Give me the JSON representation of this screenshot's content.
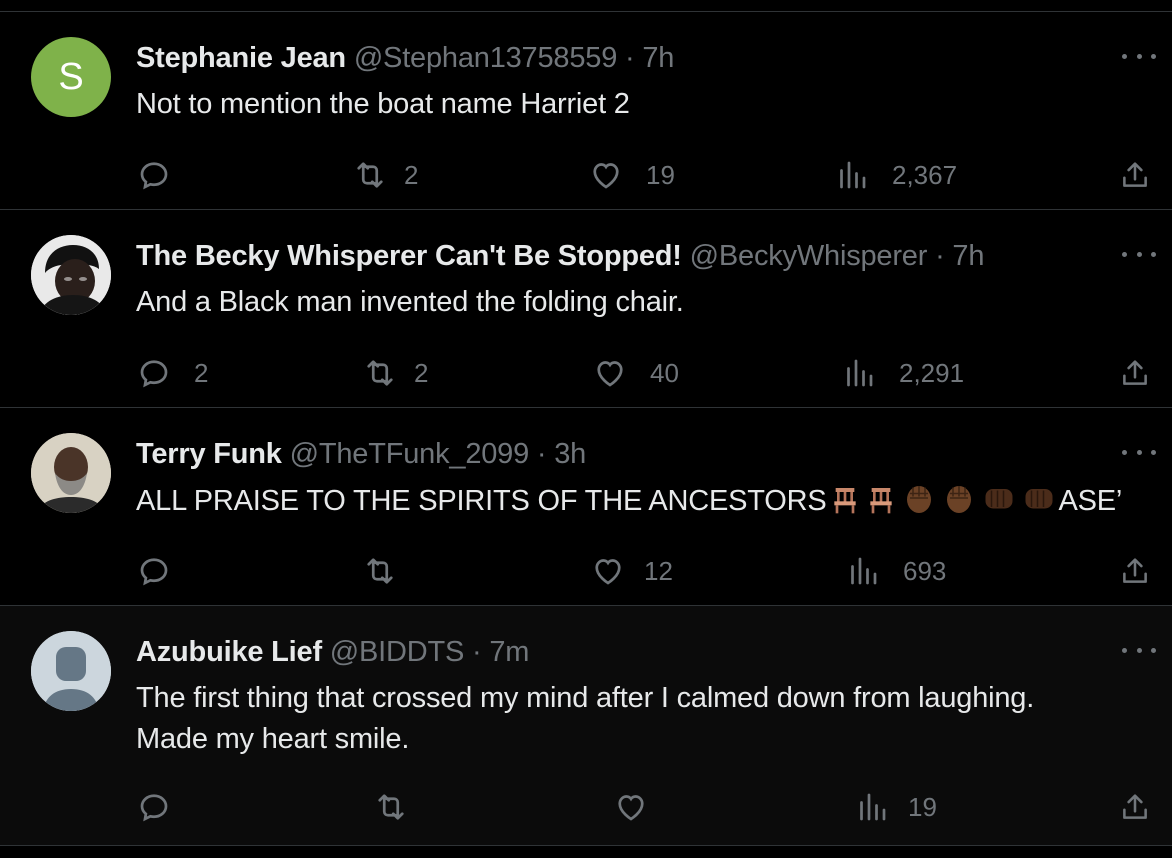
{
  "colors": {
    "background": "#000000",
    "text": "#e7e9ea",
    "muted": "#71767b",
    "divider": "#2f3336",
    "avatar_s": "#7fb24a"
  },
  "tweets": [
    {
      "avatar_letter": "S",
      "name": "Stephanie Jean",
      "handle": "@Stephan13758559",
      "separator": "·",
      "time": "7h",
      "text": "Not to mention the boat name Harriet 2",
      "replies": "",
      "retweets": "2",
      "likes": "19",
      "views": "2,367"
    },
    {
      "avatar_letter": "",
      "name": "The Becky Whisperer Can't Be Stopped!",
      "handle": "@BeckyWhisperer",
      "separator": "·",
      "time": "7h",
      "text": "And a Black man invented the folding chair.",
      "replies": "2",
      "retweets": "2",
      "likes": "40",
      "views": "2,291"
    },
    {
      "avatar_letter": "",
      "name": "Terry Funk",
      "handle": "@TheTFunk_2099",
      "separator": "·",
      "time": "3h",
      "text_before": "ALL PRAISE TO THE SPIRITS OF THE ANCESTORS",
      "text_after": "ASE’",
      "emojis": [
        "chair-emoji",
        "chair-emoji",
        "raised-fist-emoji",
        "raised-fist-emoji",
        "oncoming-fist-emoji",
        "oncoming-fist-emoji"
      ],
      "replies": "",
      "retweets": "",
      "likes": "12",
      "views": "693"
    },
    {
      "avatar_letter": "",
      "name": "Azubuike Lief",
      "handle": "@BIDDTS",
      "separator": "·",
      "time": "7m",
      "text_line1": "The first thing that crossed my mind after I calmed down from laughing.",
      "text_line2": "Made my heart smile.",
      "replies": "",
      "retweets": "",
      "likes": "",
      "views": "19"
    }
  ]
}
